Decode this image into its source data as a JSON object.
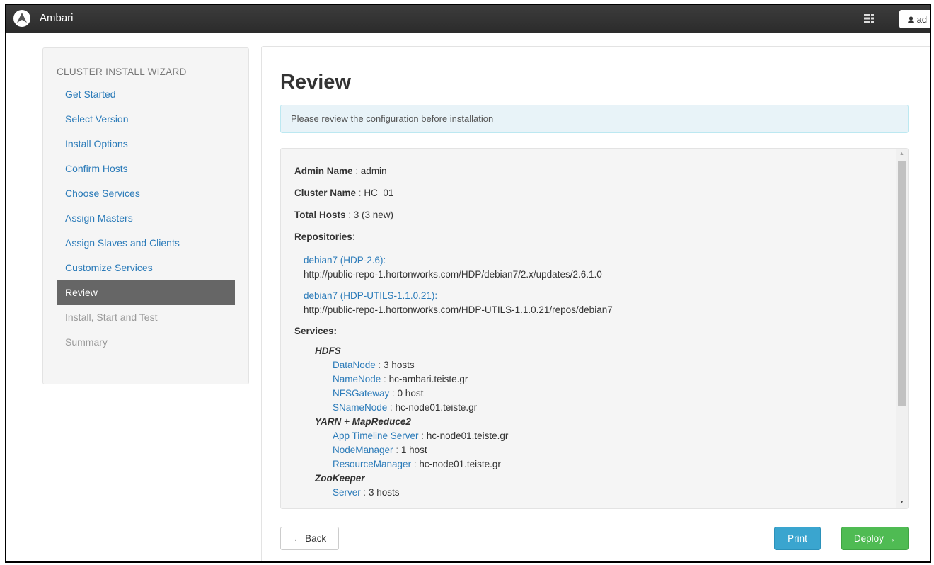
{
  "topbar": {
    "brand": "Ambari",
    "grid_icon": "apps-grid-icon",
    "user_icon": "user-icon",
    "user_label": "ad"
  },
  "sidebar": {
    "title": "CLUSTER INSTALL WIZARD",
    "items": [
      {
        "label": "Get Started",
        "state": "link"
      },
      {
        "label": "Select Version",
        "state": "link"
      },
      {
        "label": "Install Options",
        "state": "link"
      },
      {
        "label": "Confirm Hosts",
        "state": "link"
      },
      {
        "label": "Choose Services",
        "state": "link"
      },
      {
        "label": "Assign Masters",
        "state": "link"
      },
      {
        "label": "Assign Slaves and Clients",
        "state": "link"
      },
      {
        "label": "Customize Services",
        "state": "link"
      },
      {
        "label": "Review",
        "state": "active"
      },
      {
        "label": "Install, Start and Test",
        "state": "disabled"
      },
      {
        "label": "Summary",
        "state": "disabled"
      }
    ]
  },
  "main": {
    "title": "Review",
    "alert": "Please review the configuration before installation",
    "fields": [
      {
        "key": "Admin Name",
        "value": "admin"
      },
      {
        "key": "Cluster Name",
        "value": "HC_01"
      },
      {
        "key": "Total Hosts",
        "value": "3 (3 new)"
      }
    ],
    "repositories_label": "Repositories",
    "repositories": [
      {
        "name": "debian7 (HDP-2.6):",
        "url": "http://public-repo-1.hortonworks.com/HDP/debian7/2.x/updates/2.6.1.0"
      },
      {
        "name": "debian7 (HDP-UTILS-1.1.0.21):",
        "url": "http://public-repo-1.hortonworks.com/HDP-UTILS-1.1.0.21/repos/debian7"
      }
    ],
    "services_label": "Services:",
    "services": [
      {
        "name": "HDFS",
        "components": [
          {
            "name": "DataNode",
            "value": "3 hosts"
          },
          {
            "name": "NameNode",
            "value": "hc-ambari.teiste.gr"
          },
          {
            "name": "NFSGateway",
            "value": "0 host"
          },
          {
            "name": "SNameNode",
            "value": "hc-node01.teiste.gr"
          }
        ]
      },
      {
        "name": "YARN + MapReduce2",
        "components": [
          {
            "name": "App Timeline Server",
            "value": "hc-node01.teiste.gr"
          },
          {
            "name": "NodeManager",
            "value": "1 host"
          },
          {
            "name": "ResourceManager",
            "value": "hc-node01.teiste.gr"
          }
        ]
      },
      {
        "name": "ZooKeeper",
        "components": [
          {
            "name": "Server",
            "value": "3 hosts"
          }
        ]
      }
    ],
    "separator": " : "
  },
  "buttons": {
    "back": "← Back",
    "print": "Print",
    "deploy": "Deploy →"
  },
  "colors": {
    "link": "#2b7bb9",
    "active_nav_bg": "#666666",
    "print_bg": "#3aa5cf",
    "deploy_bg": "#4fbb53",
    "alert_bg": "#e8f3f8"
  }
}
